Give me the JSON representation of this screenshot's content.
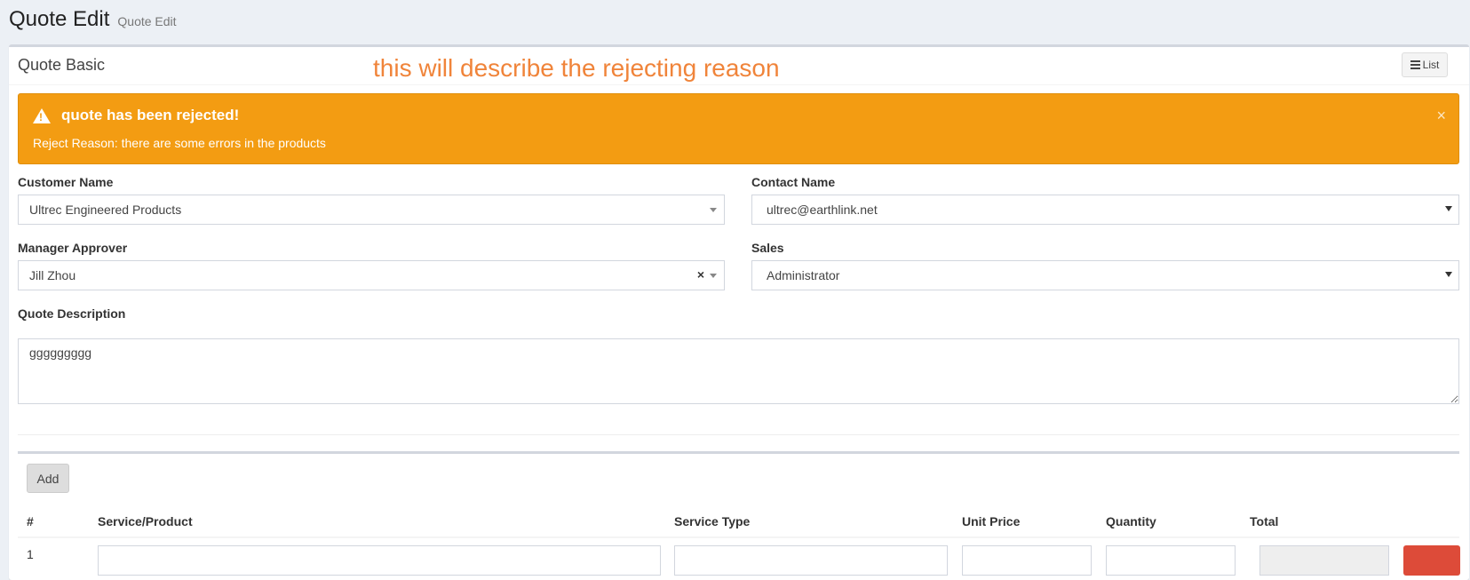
{
  "header": {
    "title": "Quote Edit",
    "subtitle": "Quote Edit"
  },
  "box": {
    "title": "Quote Basic",
    "annotation": "this will describe the rejecting reason",
    "list_button": {
      "label": "List",
      "icon": "list-icon"
    }
  },
  "alert": {
    "icon": "warning-icon",
    "title": "quote has been rejected!",
    "body": "Reject Reason: there are some errors in the products",
    "close": "×",
    "color": "#f39c12"
  },
  "form": {
    "customer_name": {
      "label": "Customer Name",
      "value": "Ultrec Engineered Products"
    },
    "contact_name": {
      "label": "Contact Name",
      "value": "ultrec@earthlink.net"
    },
    "manager_approver": {
      "label": "Manager Approver",
      "value": "Jill Zhou",
      "clear": "×"
    },
    "sales": {
      "label": "Sales",
      "value": "Administrator"
    },
    "quote_description": {
      "label": "Quote Description",
      "value": "ggggggggg"
    }
  },
  "products": {
    "add_label": "Add",
    "columns": [
      "#",
      "Service/Product",
      "Service Type",
      "Unit Price",
      "Quantity",
      "Total"
    ],
    "rows": [
      {
        "num": "1"
      }
    ]
  }
}
